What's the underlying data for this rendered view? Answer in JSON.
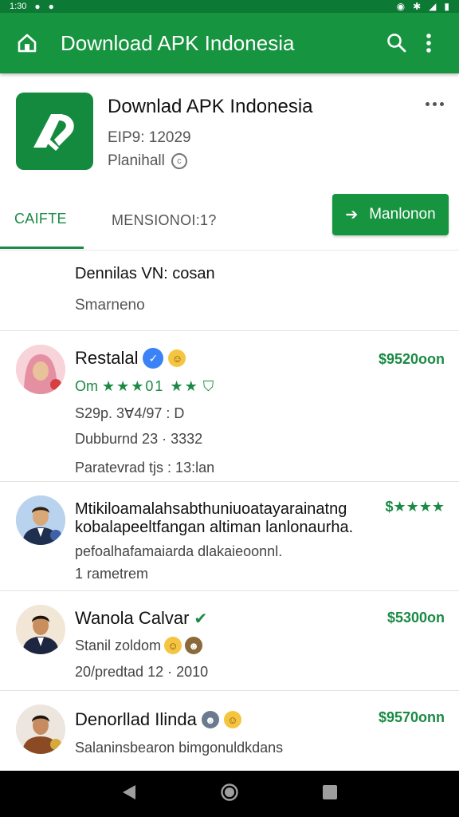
{
  "status_bar": {
    "time": "1:30"
  },
  "app_bar": {
    "title": "Download APK Indonesia"
  },
  "app": {
    "name": "Downlad APK Indonesia",
    "meta1": "EIP9: 12029",
    "meta2": "Planihall"
  },
  "tabs": {
    "active": "CAIFTE",
    "inactive": "MENSIONOI:1?"
  },
  "download_button": {
    "label": "Manlonon"
  },
  "info": {
    "title": "Dennilas VN: cosan",
    "subtitle": "Smarneno"
  },
  "rows": [
    {
      "name": "Restalal",
      "rating_text": "Om",
      "stars": "★★★01 ★★",
      "line2": "S29p. 3Ɐ4/97  :  D",
      "line3": "Dubburnd 23 · 3332",
      "line4": "Paratevrad tjs : 13:lan",
      "price": "$9520oon"
    },
    {
      "text1": "Mtikiloamalahsabthuniuoatayarainatng",
      "text2": "kobalapeeltfangan altiman lanlonaurha.",
      "text3": "pefoalhafamaiarda dlakaieoonnl.",
      "text4": "1 rametrem",
      "stars": "$★★★★"
    },
    {
      "name": "Wanola Calvar",
      "line2": "Stanil zoldom",
      "line3": "20/predtad 12 · 2010",
      "price": "$5300on"
    },
    {
      "name": "Denorllad Ilinda",
      "line2": "Salaninsbearon bimgonuldkdans",
      "price": "$9570onn"
    }
  ],
  "colors": {
    "primary": "#16943f",
    "primary_dark": "#0c7a35",
    "accent_green": "#1a8a44"
  },
  "icons": [
    "home-icon",
    "search-icon",
    "more-vert-icon",
    "more-horiz-icon",
    "download-icon",
    "verified-icon",
    "back-icon",
    "home-circle-icon",
    "recents-icon"
  ]
}
